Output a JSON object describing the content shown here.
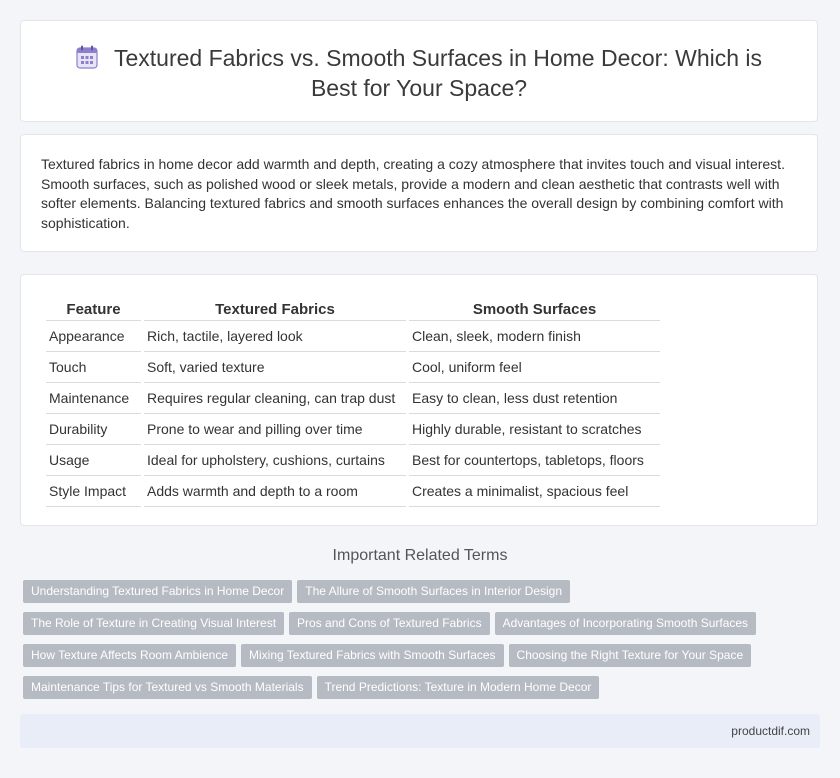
{
  "header": {
    "title_line1": "Textured Fabrics vs. Smooth Surfaces in Home Decor: Which is",
    "title_line2": "Best for Your Space?",
    "icon": "calendar-icon"
  },
  "intro": {
    "text": "Textured fabrics in home decor add warmth and depth, creating a cozy atmosphere that invites touch and visual interest. Smooth surfaces, such as polished wood or sleek metals, provide a modern and clean aesthetic that contrasts well with softer elements. Balancing textured fabrics and smooth surfaces enhances the overall design by combining comfort with sophistication."
  },
  "comparison": {
    "headers": [
      "Feature",
      "Textured Fabrics",
      "Smooth Surfaces"
    ],
    "rows": [
      [
        "Appearance",
        "Rich, tactile, layered look",
        "Clean, sleek, modern finish"
      ],
      [
        "Touch",
        "Soft, varied texture",
        "Cool, uniform feel"
      ],
      [
        "Maintenance",
        "Requires regular cleaning, can trap dust",
        "Easy to clean, less dust retention"
      ],
      [
        "Durability",
        "Prone to wear and pilling over time",
        "Highly durable, resistant to scratches"
      ],
      [
        "Usage",
        "Ideal for upholstery, cushions, curtains",
        "Best for countertops, tabletops, floors"
      ],
      [
        "Style Impact",
        "Adds warmth and depth to a room",
        "Creates a minimalist, spacious feel"
      ]
    ]
  },
  "related": {
    "title": "Important Related Terms",
    "rows": [
      [
        "Understanding Textured Fabrics in Home Decor",
        "The Allure of Smooth Surfaces in Interior Design"
      ],
      [
        "The Role of Texture in Creating Visual Interest",
        "Pros and Cons of Textured Fabrics",
        "Advantages of Incorporating Smooth Surfaces"
      ],
      [
        "How Texture Affects Room Ambience",
        "Mixing Textured Fabrics with Smooth Surfaces",
        "Choosing the Right Texture for Your Space"
      ],
      [
        "Maintenance Tips for Textured vs Smooth Materials",
        "Trend Predictions: Texture in Modern Home Decor"
      ]
    ]
  },
  "footer": {
    "site": "productdif.com"
  }
}
